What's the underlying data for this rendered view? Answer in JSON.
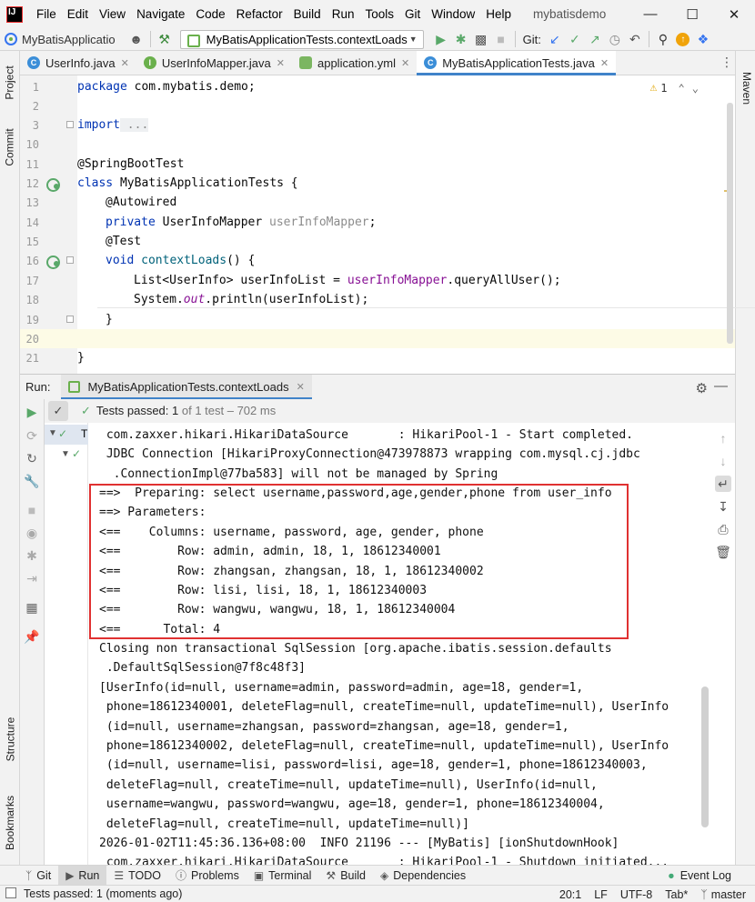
{
  "window": {
    "title": "mybatisdemo",
    "menu": [
      "File",
      "Edit",
      "View",
      "Navigate",
      "Code",
      "Refactor",
      "Build",
      "Run",
      "Tools",
      "Git",
      "Window",
      "Help"
    ]
  },
  "toolbar": {
    "project": "MyBatisApplicatio",
    "run_config": "MyBatisApplicationTests.contextLoads",
    "git_label": "Git:"
  },
  "left_strip": {
    "project": "Project",
    "commit": "Commit",
    "structure": "Structure",
    "bookmarks": "Bookmarks"
  },
  "right_strip": {
    "maven": "Maven"
  },
  "editor_tabs": [
    {
      "label": "UserInfo.java",
      "color": "#3b8ed8",
      "glyph": "C"
    },
    {
      "label": "UserInfoMapper.java",
      "color": "#6ab04c",
      "glyph": "I"
    },
    {
      "label": "application.yml",
      "color": "#7bb661",
      "glyph": ""
    },
    {
      "label": "MyBatisApplicationTests.java",
      "color": "#3b8ed8",
      "glyph": "C"
    }
  ],
  "editor": {
    "warnings": "1",
    "line_numbers": [
      "1",
      "2",
      "3",
      "10",
      "11",
      "12",
      "13",
      "14",
      "15",
      "16",
      "17",
      "18",
      "19",
      "20",
      "21"
    ],
    "lines": {
      "l1": {
        "kw": "package",
        "rest": " com.mybatis.demo;"
      },
      "l3": {
        "kw": "import",
        "rest": " ..."
      },
      "l11": "@SpringBootTest",
      "l12": {
        "kw": "class",
        "rest": " MyBatisApplicationTests {"
      },
      "l13": "@Autowired",
      "l14": {
        "kw": "private",
        "type": " UserInfoMapper ",
        "field": "userInfoMapper",
        "end": ";"
      },
      "l15": "@Test",
      "l16": {
        "kw": "void",
        "meth": " contextLoads",
        "end": "() {"
      },
      "l17": {
        "a": "List<UserInfo> userInfoList = ",
        "field": "userInfoMapper",
        "b": ".queryAllUser();"
      },
      "l18": {
        "a": "System.",
        "field": "out",
        "b": ".println(userInfoList);"
      },
      "l19": "}",
      "l21": "}"
    }
  },
  "run_panel": {
    "label": "Run:",
    "tab": "MyBatisApplicationTests.contextLoads",
    "tests_passed_a": "Tests passed:",
    "tests_passed_b": " 1",
    "tests_passed_c": " of 1 test – 702 ms",
    "tree_first": "T",
    "console": [
      " com.zaxxer.hikari.HikariDataSource       : HikariPool-1 - Start completed.",
      " JDBC Connection [HikariProxyConnection@473978873 wrapping com.mysql.cj.jdbc",
      "  .ConnectionImpl@77ba583] will not be managed by Spring",
      "==>  Preparing: select username,password,age,gender,phone from user_info",
      "==> Parameters: ",
      "<==    Columns: username, password, age, gender, phone",
      "<==        Row: admin, admin, 18, 1, 18612340001",
      "<==        Row: zhangsan, zhangsan, 18, 1, 18612340002",
      "<==        Row: lisi, lisi, 18, 1, 18612340003",
      "<==        Row: wangwu, wangwu, 18, 1, 18612340004",
      "<==      Total: 4",
      "Closing non transactional SqlSession [org.apache.ibatis.session.defaults",
      " .DefaultSqlSession@7f8c48f3]",
      "[UserInfo(id=null, username=admin, password=admin, age=18, gender=1,",
      " phone=18612340001, deleteFlag=null, createTime=null, updateTime=null), UserInfo",
      " (id=null, username=zhangsan, password=zhangsan, age=18, gender=1,",
      " phone=18612340002, deleteFlag=null, createTime=null, updateTime=null), UserInfo",
      " (id=null, username=lisi, password=lisi, age=18, gender=1, phone=18612340003,",
      " deleteFlag=null, createTime=null, updateTime=null), UserInfo(id=null,",
      " username=wangwu, password=wangwu, age=18, gender=1, phone=18612340004,",
      " deleteFlag=null, createTime=null, updateTime=null)]",
      "2026-01-02T11:45:36.136+08:00  INFO 21196 --- [MyBatis] [ionShutdownHook]",
      " com.zaxxer.hikari.HikariDataSource       : HikariPool-1 - Shutdown initiated..."
    ]
  },
  "bottom_bar": {
    "items": [
      "Git",
      "Run",
      "TODO",
      "Problems",
      "Terminal",
      "Build",
      "Dependencies"
    ],
    "event_log": "Event Log"
  },
  "status_bar": {
    "message": "Tests passed: 1 (moments ago)",
    "position": "20:1",
    "line_sep": "LF",
    "encoding": "UTF-8",
    "indent": "Tab*",
    "branch": "master"
  },
  "colors": {
    "highlight_box": "#e03131",
    "accent": "#4083c9",
    "success": "#59a869"
  }
}
